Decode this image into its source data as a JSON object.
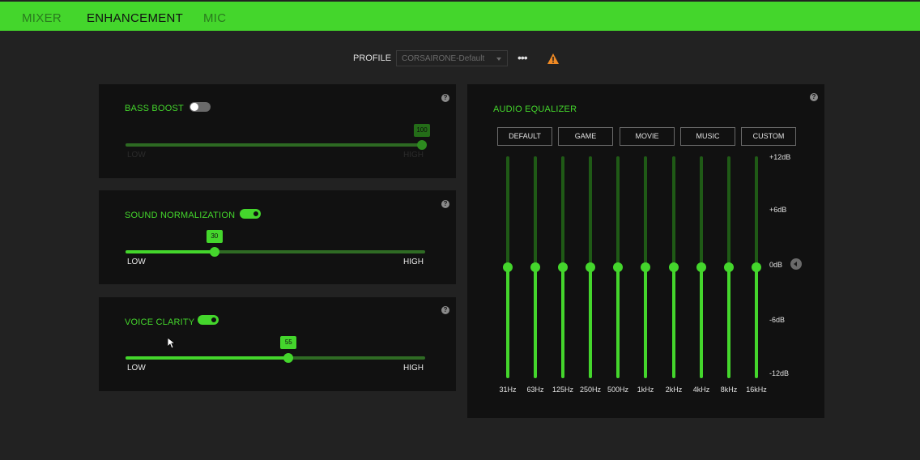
{
  "tabs": [
    {
      "label": "MIXER",
      "active": false
    },
    {
      "label": "ENHANCEMENT",
      "active": true
    },
    {
      "label": "MIC",
      "active": false
    }
  ],
  "profile": {
    "label": "PROFILE",
    "selected": "CORSAIRONE-Default",
    "more": "•••",
    "warning_icon": "warning-triangle-icon"
  },
  "bass_boost": {
    "title": "BASS BOOST",
    "enabled": false,
    "value": 100,
    "badge": "100",
    "low_label": "LOW",
    "high_label": "HIGH"
  },
  "sound_normalization": {
    "title": "SOUND NORMALIZATION",
    "enabled": true,
    "value": 30,
    "badge": "30",
    "low_label": "LOW",
    "high_label": "HIGH"
  },
  "voice_clarity": {
    "title": "VOICE CLARITY",
    "enabled": true,
    "value": 55,
    "badge": "55",
    "low_label": "LOW",
    "high_label": "HIGH"
  },
  "help_icon_glyph": "?",
  "equalizer": {
    "title": "AUDIO EQUALIZER",
    "presets": [
      {
        "label": "DEFAULT",
        "active": true
      },
      {
        "label": "GAME",
        "active": false
      },
      {
        "label": "MOVIE",
        "active": false
      },
      {
        "label": "MUSIC",
        "active": false
      },
      {
        "label": "CUSTOM",
        "active": false
      }
    ],
    "db_labels": [
      "+12dB",
      "+6dB",
      "0dB",
      "-6dB",
      "-12dB"
    ],
    "bands": [
      {
        "freq": "31Hz",
        "gain_db": 0
      },
      {
        "freq": "63Hz",
        "gain_db": 0
      },
      {
        "freq": "125Hz",
        "gain_db": 0
      },
      {
        "freq": "250Hz",
        "gain_db": 0
      },
      {
        "freq": "500Hz",
        "gain_db": 0
      },
      {
        "freq": "1kHz",
        "gain_db": 0
      },
      {
        "freq": "2kHz",
        "gain_db": 0
      },
      {
        "freq": "4kHz",
        "gain_db": 0
      },
      {
        "freq": "8kHz",
        "gain_db": 0
      },
      {
        "freq": "16kHz",
        "gain_db": 0
      }
    ],
    "gain_range_db": [
      -12,
      12
    ]
  },
  "colors": {
    "accent": "#44d62c",
    "panel": "#111111",
    "background": "#222222"
  }
}
